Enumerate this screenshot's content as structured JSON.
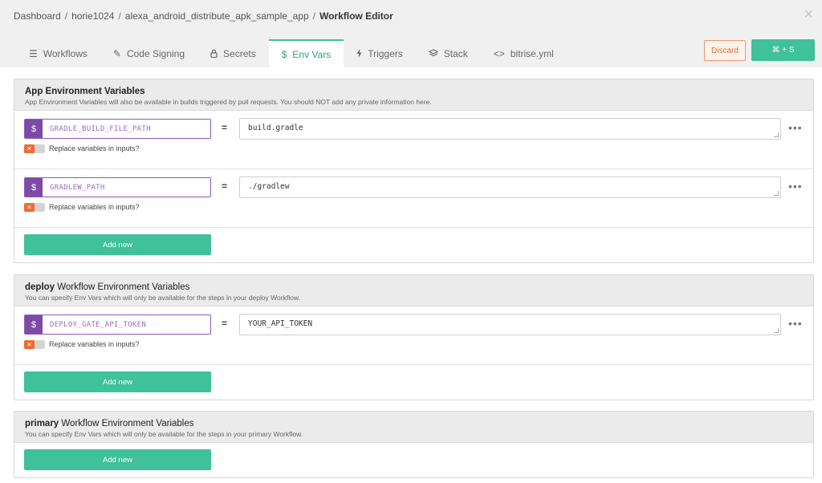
{
  "breadcrumb": {
    "items": [
      "Dashboard",
      "horie1024",
      "alexa_android_distribute_apk_sample_app"
    ],
    "separator": "/",
    "current": "Workflow Editor"
  },
  "close_label": "✕",
  "tabs": [
    {
      "icon": "list-icon",
      "glyph": "☰",
      "label": "Workflows",
      "active": false
    },
    {
      "icon": "code-signing-icon",
      "glyph": "✎",
      "label": "Code Signing",
      "active": false
    },
    {
      "icon": "lock-icon",
      "glyph": "🔒",
      "label": "Secrets",
      "active": false
    },
    {
      "icon": "dollar-icon",
      "glyph": "$",
      "label": "Env Vars",
      "active": true
    },
    {
      "icon": "lightning-icon",
      "glyph": "⚡",
      "label": "Triggers",
      "active": false
    },
    {
      "icon": "stack-icon",
      "glyph": "≋",
      "label": "Stack",
      "active": false
    },
    {
      "icon": "code-icon",
      "glyph": "<>",
      "label": "bitrise.yml",
      "active": false
    }
  ],
  "actions": {
    "discard_label": "Discard",
    "save_label": "⌘ + S"
  },
  "colors": {
    "accent": "#3fc19a",
    "purple": "#7d4aa6",
    "orange": "#ef6c2f"
  },
  "sections": {
    "app": {
      "title_bold": "App Environment Variables",
      "title_rest": "",
      "description": "App Environment Variables will also be available in builds triggered by pull requests. You should NOT add any private information here.",
      "vars": [
        {
          "key": "GRADLE_BUILD_FILE_PATH",
          "value": "build.gradle",
          "toggle_label": "Replace variables in inputs?"
        },
        {
          "key": "GRADLEW_PATH",
          "value": "./gradlew",
          "toggle_label": "Replace variables in inputs?"
        }
      ],
      "add_label": "Add new"
    },
    "deploy": {
      "title_bold": "deploy",
      "title_rest": " Workflow Environment Variables",
      "description": "You can specify Env Vars which will only be available for the steps in your deploy Workflow.",
      "vars": [
        {
          "key": "DEPLOY_GATE_API_TOKEN",
          "value": "YOUR_API_TOKEN",
          "toggle_label": "Replace variables in inputs?"
        }
      ],
      "add_label": "Add new"
    },
    "primary": {
      "title_bold": "primary",
      "title_rest": " Workflow Environment Variables",
      "description": "You can specify Env Vars which will only be available for the steps in your primary Workflow.",
      "vars": [],
      "add_label": "Add new"
    }
  },
  "dollar_glyph": "$",
  "equals_glyph": "=",
  "more_glyph": "•••",
  "toggle_glyph": "✕"
}
